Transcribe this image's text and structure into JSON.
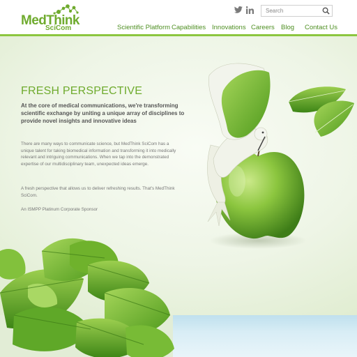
{
  "brand": {
    "logo_main": "MedThink",
    "logo_sub": "SciCom",
    "accent_color": "#6fab2e",
    "rule_color": "#8cc63f"
  },
  "social": [
    {
      "icon": "twitter-icon"
    },
    {
      "icon": "linkedin-icon"
    }
  ],
  "search": {
    "placeholder": "Search",
    "icon": "search-icon"
  },
  "nav": {
    "items": [
      {
        "label": "Scientific Platform"
      },
      {
        "label": "Capabilities"
      },
      {
        "label": "Innovations"
      },
      {
        "label": "Careers"
      },
      {
        "label": "Blog"
      },
      {
        "label": "Contact Us"
      }
    ]
  },
  "hero": {
    "title": "FRESH PERSPECTIVE",
    "lead": "At the core of medical communications, we're transforming scientific exchange by uniting a unique array of disciplines to provide novel insights and innovative ideas",
    "paragraphs": [
      "There are many ways to communicate science, but MedThink SciCom has a unique talent for taking biomedical information and transforming it into medically relevant and intriguing communications. When we tap into the demonstrated expertise of our multidisciplinary team, unexpected ideas emerge.",
      "A fresh perspective that allows us to deliver refreshing results. That's MedThink SciCom.",
      "An ISMPP Platinum Corporate Sponsor"
    ]
  }
}
